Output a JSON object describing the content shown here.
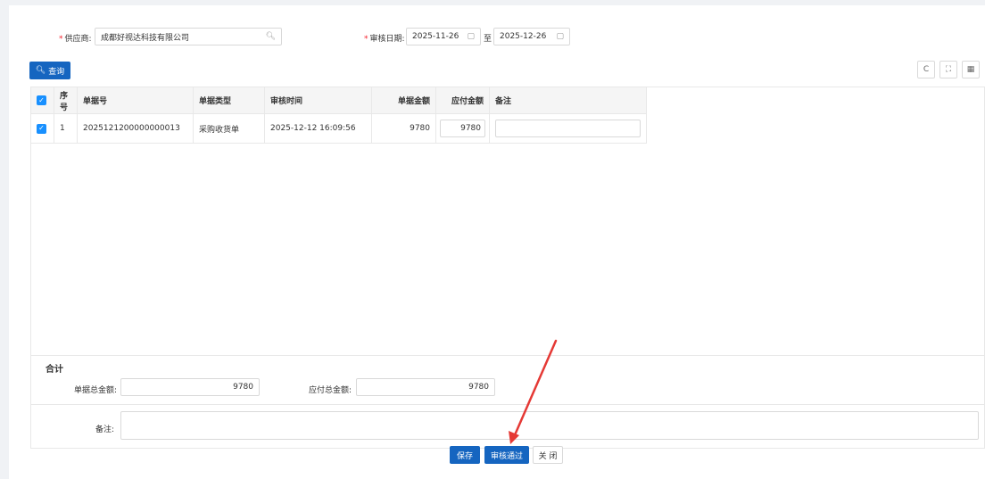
{
  "filters": {
    "supplier_label": "供应商:",
    "supplier_value": "成都好视达科技有限公司",
    "date_label": "审核日期:",
    "date_from": "2025-11-26",
    "date_sep": "至",
    "date_to": "2025-12-26"
  },
  "toolbar": {
    "query_label": "查询",
    "refresh_icon": "C",
    "fullscreen_icon": "⛶",
    "columns_icon": "▦"
  },
  "table": {
    "columns": [
      "序号",
      "单据号",
      "单据类型",
      "审核时间",
      "单据金额",
      "应付金额",
      "备注"
    ],
    "rows": [
      {
        "index": "1",
        "doc_no": "2025121200000000013",
        "doc_type": "采购收货单",
        "audit_time": "2025-12-12 16:09:56",
        "doc_amount": "9780",
        "payable_amount": "9780",
        "remark": ""
      }
    ]
  },
  "summary": {
    "title": "合计",
    "doc_total_label": "单据总金额:",
    "doc_total_value": "9780",
    "payable_total_label": "应付总金额:",
    "payable_total_value": "9780",
    "remark_label": "备注:",
    "remark_value": ""
  },
  "actions": {
    "save_label": "保存",
    "approve_label": "审核通过",
    "close_label": "关 闭"
  },
  "colors": {
    "primary": "#1565c0",
    "checkbox": "#1890ff",
    "annotation_arrow": "#e53935"
  }
}
